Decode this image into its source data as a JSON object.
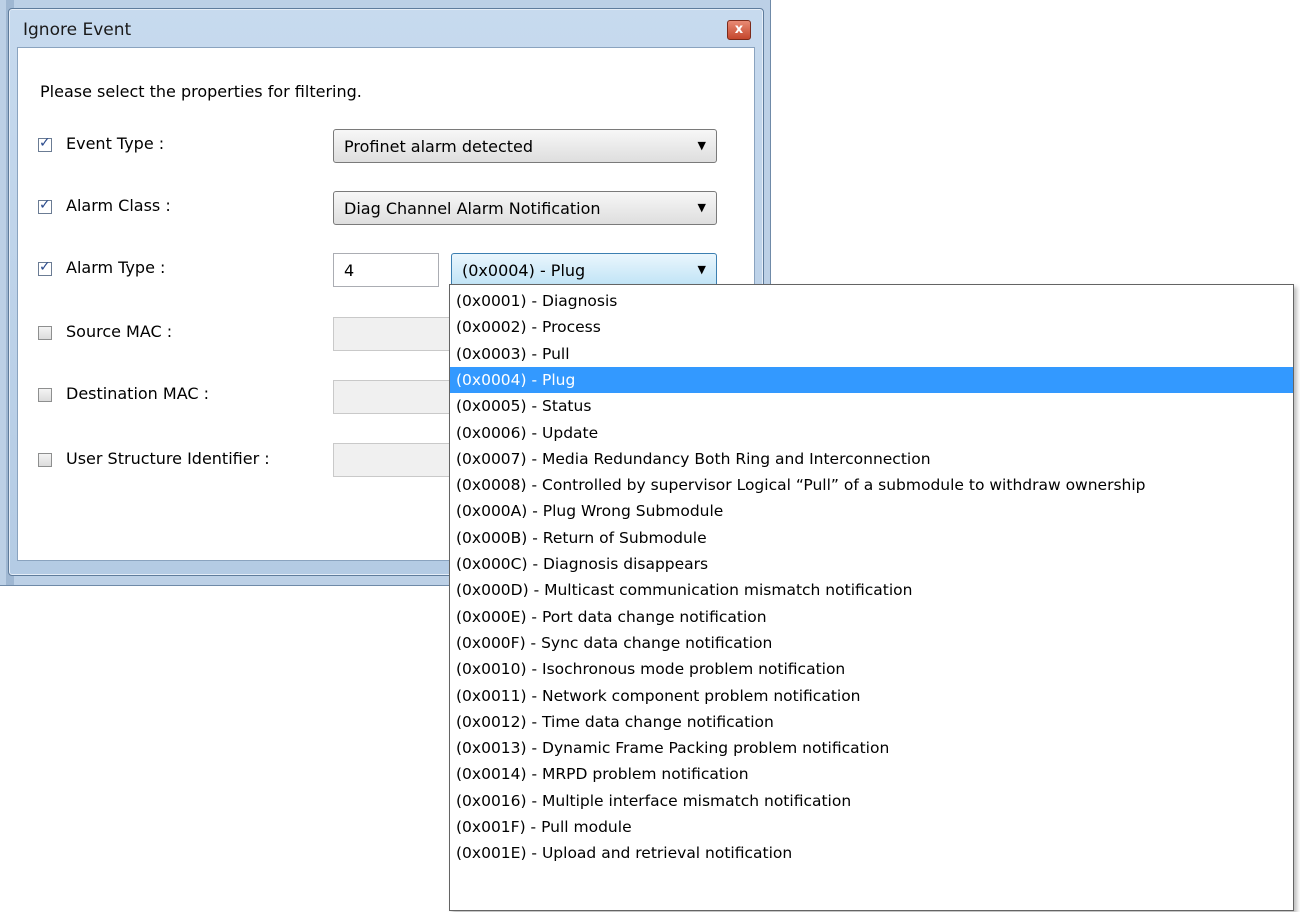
{
  "dialog": {
    "title": "Ignore Event",
    "close_label": "x",
    "instruction": "Please select the properties for filtering."
  },
  "rows": {
    "event_type": {
      "label": "Event Type  :",
      "checked": true,
      "value": "Profinet alarm detected"
    },
    "alarm_class": {
      "label": "Alarm Class  :",
      "checked": true,
      "value": "Diag Channel Alarm Notification"
    },
    "alarm_type": {
      "label": "Alarm Type  :",
      "checked": true,
      "number": "4",
      "value": "(0x0004) - Plug"
    },
    "source_mac": {
      "label": "Source MAC  :",
      "checked": false
    },
    "destination_mac": {
      "label": "Destination MAC  :",
      "checked": false
    },
    "user_structure": {
      "label": "User Structure Identifier  :",
      "checked": false
    }
  },
  "dropdown": {
    "selected_index": 3,
    "options": [
      "(0x0001) - Diagnosis",
      "(0x0002) - Process",
      "(0x0003) - Pull",
      "(0x0004) - Plug",
      "(0x0005) - Status",
      "(0x0006) - Update",
      "(0x0007) - Media Redundancy Both Ring and Interconnection",
      "(0x0008) - Controlled by supervisor Logical “Pull” of a submodule to withdraw ownership",
      "(0x000A) - Plug Wrong Submodule",
      "(0x000B) - Return of Submodule",
      "(0x000C) - Diagnosis disappears",
      "(0x000D) - Multicast communication mismatch notification",
      "(0x000E) - Port data change notification",
      "(0x000F) - Sync data change notification",
      "(0x0010) - Isochronous mode problem notification",
      "(0x0011) - Network component problem notification",
      "(0x0012) - Time data change notification",
      "(0x0013) - Dynamic Frame Packing problem notification",
      "(0x0014) - MRPD problem notification",
      "(0x0016) - Multiple interface mismatch notification",
      "(0x001F) - Pull module",
      "(0x001E) - Upload and retrieval notification"
    ]
  },
  "colors": {
    "selection": "#3399ff",
    "dialog_frame": "#b4cbe4"
  }
}
